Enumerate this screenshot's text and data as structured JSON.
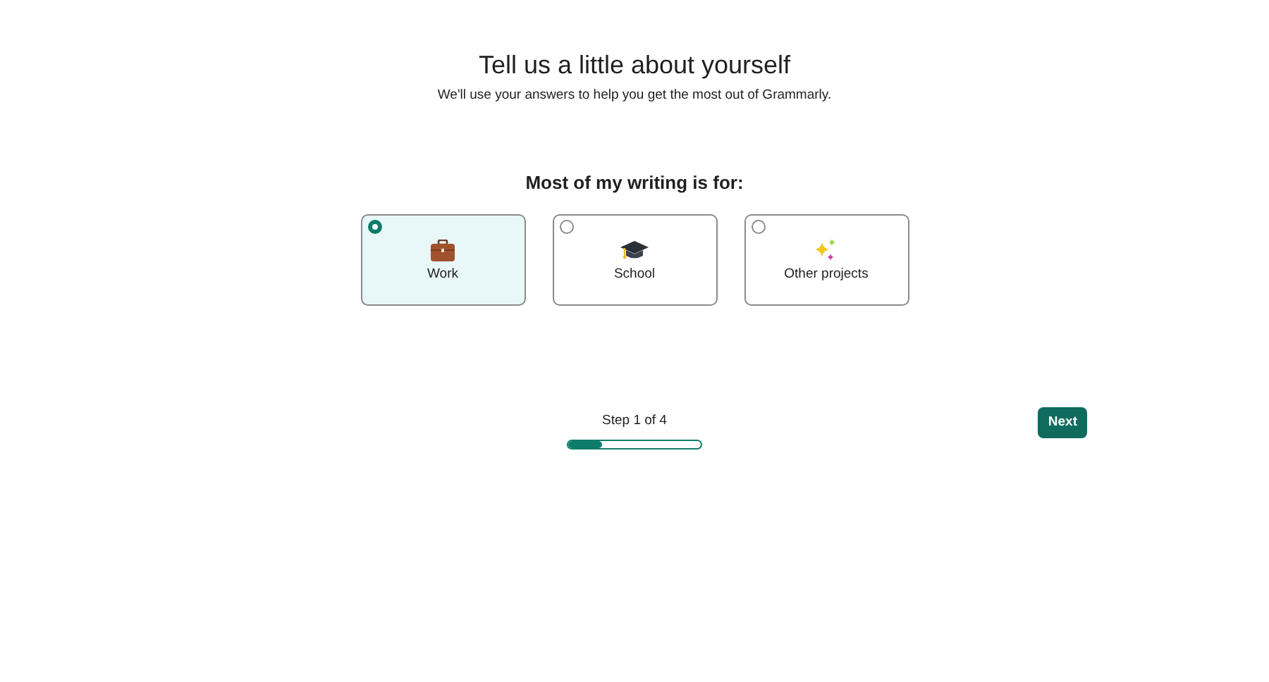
{
  "heading": "Tell us a little about yourself",
  "subheading": "We'll use your answers to help you get the most out of Grammarly.",
  "question": "Most of my writing is for:",
  "options": [
    {
      "label": "Work",
      "kind": "work",
      "selected": true
    },
    {
      "label": "School",
      "kind": "school",
      "selected": false
    },
    {
      "label": "Other projects",
      "kind": "other",
      "selected": false
    }
  ],
  "progress": {
    "label": "Step 1 of 4",
    "level": 0.25
  },
  "next_button": "Next"
}
